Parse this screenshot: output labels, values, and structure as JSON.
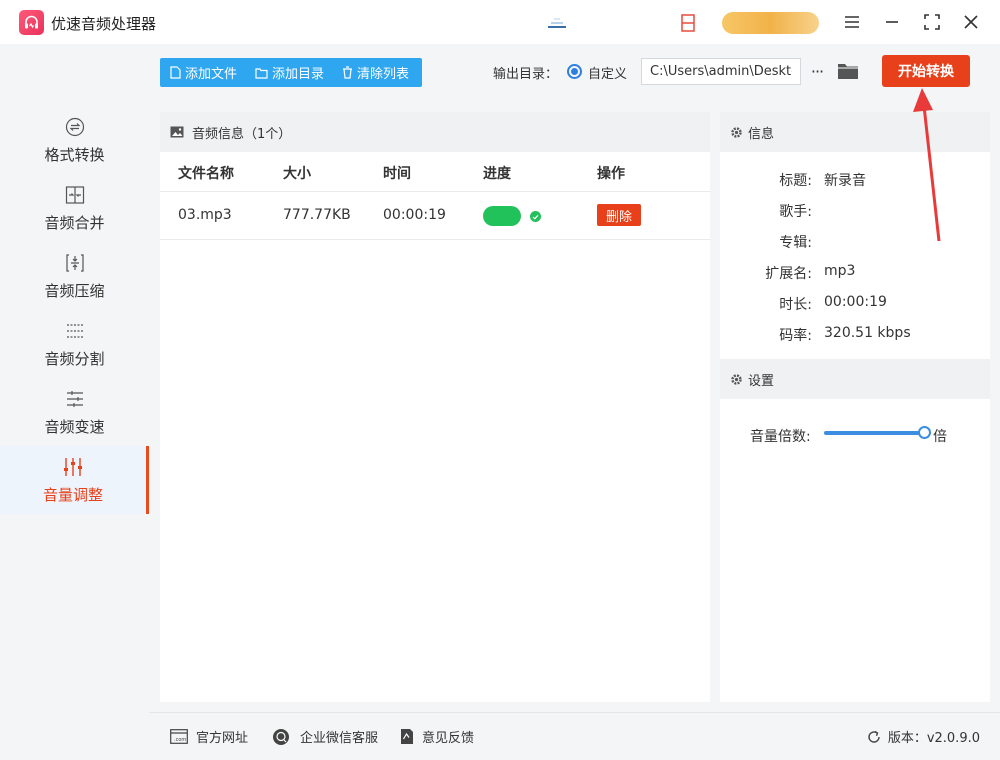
{
  "app": {
    "title": "优速音频处理器"
  },
  "sidebar": {
    "items": [
      {
        "label": "格式转换",
        "icon": "format-convert-icon"
      },
      {
        "label": "音频合并",
        "icon": "merge-icon"
      },
      {
        "label": "音频压缩",
        "icon": "compress-icon"
      },
      {
        "label": "音频分割",
        "icon": "split-icon"
      },
      {
        "label": "音频变速",
        "icon": "speed-icon"
      },
      {
        "label": "音量调整",
        "icon": "volume-adjust-icon",
        "active": true
      }
    ]
  },
  "toolbar": {
    "add_file": "添加文件",
    "add_dir": "添加目录",
    "clear_list": "清除列表",
    "output_label": "输出目录：",
    "output_option": "自定义",
    "output_path": "C:\\Users\\admin\\Deskto",
    "more": "···",
    "start": "开始转换"
  },
  "file_panel": {
    "header": "音频信息（1个）",
    "columns": [
      "文件名称",
      "大小",
      "时间",
      "进度",
      "操作"
    ],
    "rows": [
      {
        "name": "03.mp3",
        "size": "777.77KB",
        "time": "00:00:19",
        "progress": 1.0,
        "status": "done",
        "action": "删除"
      }
    ]
  },
  "info_panel": {
    "header": "信息",
    "fields": [
      {
        "key": "标题:",
        "value": "新录音"
      },
      {
        "key": "歌手:",
        "value": ""
      },
      {
        "key": "专辑:",
        "value": ""
      },
      {
        "key": "扩展名:",
        "value": "mp3"
      },
      {
        "key": "时长:",
        "value": "00:00:19"
      },
      {
        "key": "码率:",
        "value": "320.51 kbps"
      }
    ]
  },
  "settings_panel": {
    "header": "设置",
    "volume_label": "音量倍数:",
    "volume_level": 1.0,
    "volume_unit": "倍"
  },
  "footer": {
    "website": "官方网址",
    "wechat": "企业微信客服",
    "feedback": "意见反馈",
    "version": "版本：v2.0.9.0"
  },
  "colors": {
    "accent_red": "#e8401a",
    "toolbar_blue": "#2fa6f0",
    "progress_green": "#22c25a",
    "slider_blue": "#3b8ee0"
  }
}
